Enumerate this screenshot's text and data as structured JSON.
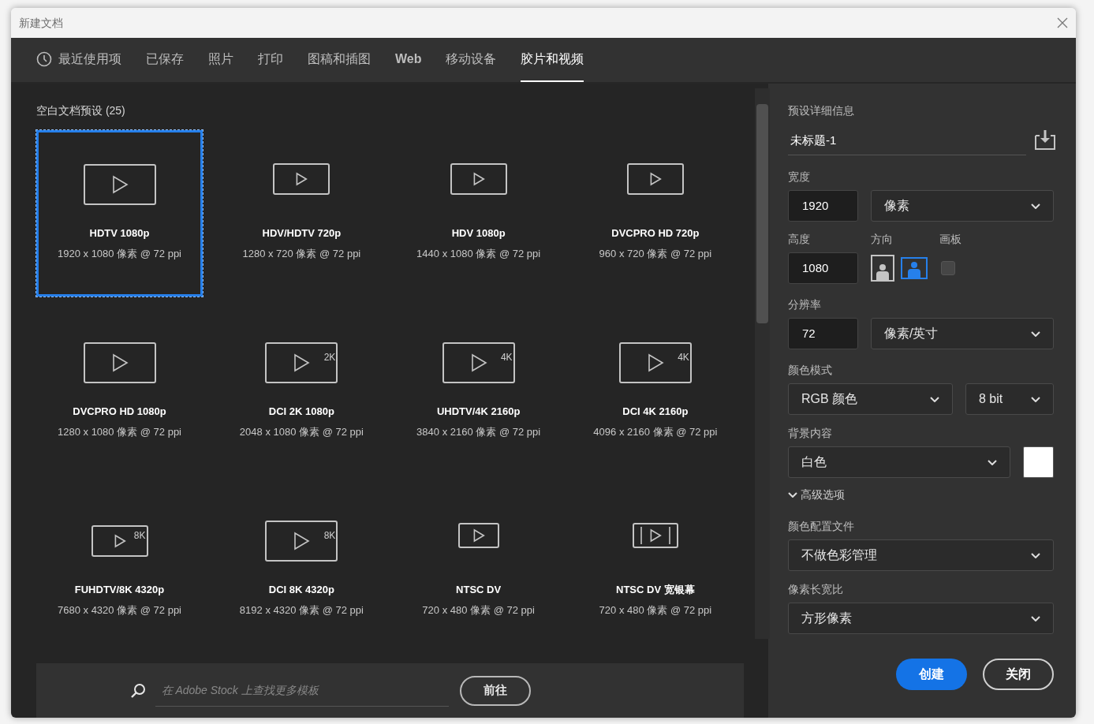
{
  "window": {
    "title": "新建文档"
  },
  "tabs": [
    {
      "label": "最近使用项",
      "selected": false
    },
    {
      "label": "已保存",
      "selected": false
    },
    {
      "label": "照片",
      "selected": false
    },
    {
      "label": "打印",
      "selected": false
    },
    {
      "label": "图稿和插图",
      "selected": false
    },
    {
      "label": "Web",
      "selected": false
    },
    {
      "label": "移动设备",
      "selected": false
    },
    {
      "label": "胶片和视频",
      "selected": true
    }
  ],
  "presets": {
    "heading": "空白文档预设 (25)",
    "items": [
      {
        "title": "HDTV 1080p",
        "size": "1920 x 1080 像素 @ 72 ppi",
        "kind": "large",
        "selected": true
      },
      {
        "title": "HDV/HDTV 720p",
        "size": "1280 x 720 像素 @ 72 ppi",
        "kind": "medium",
        "selected": false
      },
      {
        "title": "HDV 1080p",
        "size": "1440 x 1080 像素 @ 72 ppi",
        "kind": "medium",
        "selected": false
      },
      {
        "title": "DVCPRO HD 720p",
        "size": "960 x 720 像素 @ 72 ppi",
        "kind": "medium",
        "selected": false
      },
      {
        "title": "DVCPRO HD 1080p",
        "size": "1280 x 1080 像素 @ 72 ppi",
        "kind": "large",
        "selected": false
      },
      {
        "title": "DCI 2K 1080p",
        "size": "2048 x 1080 像素 @ 72 ppi",
        "kind": "large",
        "badge": "2K",
        "selected": false
      },
      {
        "title": "UHDTV/4K 2160p",
        "size": "3840 x 2160 像素 @ 72 ppi",
        "kind": "large",
        "badge": "4K",
        "selected": false
      },
      {
        "title": "DCI 4K 2160p",
        "size": "4096 x 2160 像素 @ 72 ppi",
        "kind": "large",
        "badge": "4K",
        "selected": false
      },
      {
        "title": "FUHDTV/8K 4320p",
        "size": "7680 x 4320 像素 @ 72 ppi",
        "kind": "medium",
        "badge": "8K",
        "selected": false
      },
      {
        "title": "DCI 8K 4320p",
        "size": "8192 x 4320 像素 @ 72 ppi",
        "kind": "large",
        "badge": "8K",
        "selected": false
      },
      {
        "title": "NTSC DV",
        "size": "720 x 480 像素 @ 72 ppi",
        "kind": "small",
        "selected": false
      },
      {
        "title": "NTSC DV 宽银幕",
        "size": "720 x 480 像素 @ 72 ppi",
        "kind": "widescreen",
        "selected": false
      }
    ]
  },
  "stock_search": {
    "placeholder": "在 Adobe Stock 上查找更多模板",
    "button": "前往"
  },
  "details": {
    "heading": "预设详细信息",
    "name": "未标题-1",
    "width": {
      "label": "宽度",
      "value": "1920",
      "unit": "像素"
    },
    "height": {
      "label": "高度",
      "value": "1080"
    },
    "orientation": {
      "label": "方向",
      "options": [
        {
          "kind": "portrait",
          "selected": false
        },
        {
          "kind": "landscape",
          "selected": true
        }
      ]
    },
    "artboard": {
      "label": "画板",
      "checked": false
    },
    "resolution": {
      "label": "分辨率",
      "value": "72",
      "unit": "像素/英寸"
    },
    "color_mode": {
      "label": "颜色模式",
      "mode": "RGB 颜色",
      "depth": "8 bit"
    },
    "background": {
      "label": "背景内容",
      "value": "白色",
      "color": "#ffffff"
    },
    "advanced": {
      "label": "高级选项",
      "expanded": true
    },
    "color_profile": {
      "label": "颜色配置文件",
      "value": "不做色彩管理"
    },
    "pixel_aspect": {
      "label": "像素长宽比",
      "value": "方形像素"
    }
  },
  "buttons": {
    "create": "创建",
    "close": "关闭"
  }
}
